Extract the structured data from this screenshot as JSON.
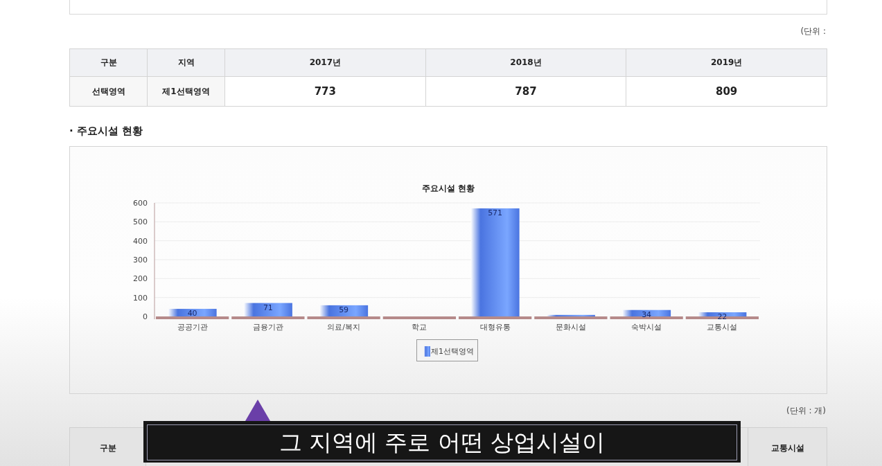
{
  "top_table": {
    "unit": "(단위 :",
    "columns": [
      "구분",
      "지역",
      "2017년",
      "2018년",
      "2019년"
    ],
    "rows": [
      [
        "선택영역",
        "제1선택영역",
        "773",
        "787",
        "809"
      ]
    ]
  },
  "section_title": "· 주요시설 현황",
  "chart_data": {
    "type": "bar",
    "title": "주요시설 현황",
    "categories": [
      "공공기관",
      "금융기관",
      "의료/복지",
      "학교",
      "대형유통",
      "문화시설",
      "숙박시설",
      "교통시설"
    ],
    "series": [
      {
        "name": "제1선택영역",
        "color": "#4a74e0",
        "values": [
          40,
          71,
          59,
          null,
          571,
          8,
          34,
          22
        ]
      }
    ],
    "grid": true,
    "ylim": [
      0,
      600
    ],
    "yticks": [
      0,
      100,
      200,
      300,
      400,
      500,
      600
    ],
    "value_labels": [
      "40",
      "71",
      "59",
      null,
      "571",
      null,
      "34",
      "22"
    ]
  },
  "bottom_table": {
    "unit": "(단위 : 개)",
    "header": [
      "구분",
      "교통시설"
    ]
  },
  "subtitle": "그 지역에 주로 어떤 상업시설이"
}
